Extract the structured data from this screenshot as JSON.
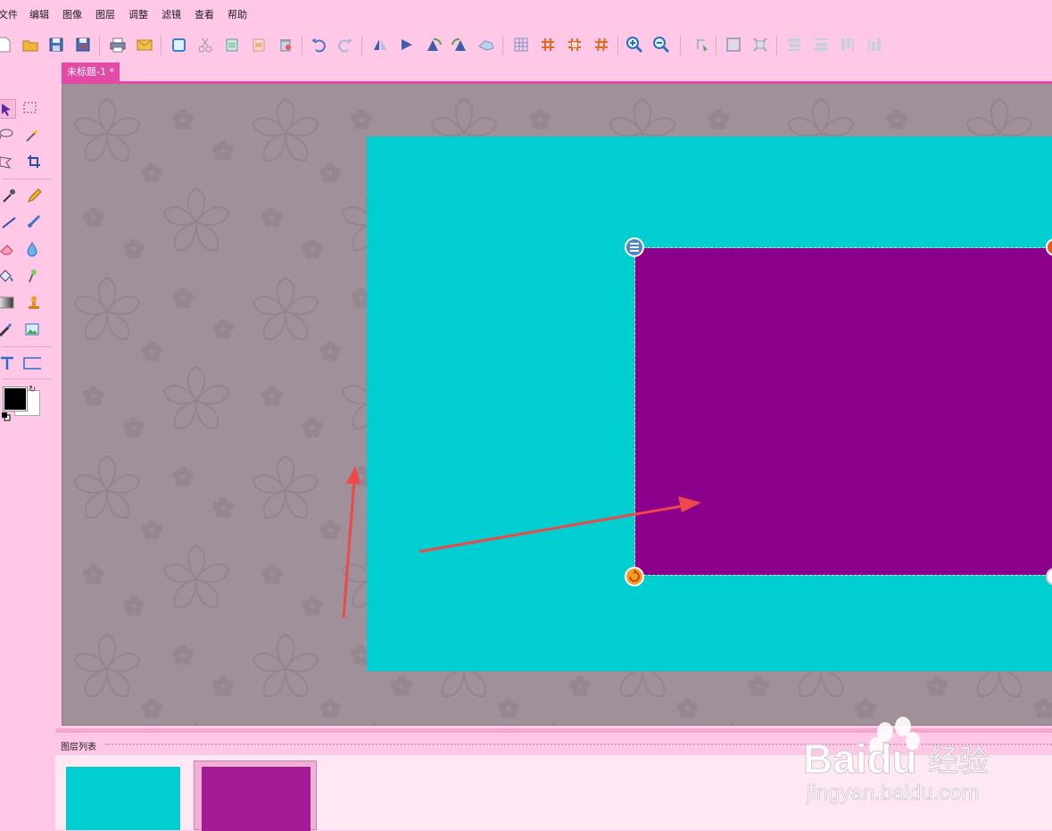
{
  "menu": [
    "文件",
    "编辑",
    "图像",
    "图层",
    "调整",
    "滤镜",
    "查看",
    "帮助"
  ],
  "toolbar_icons": [
    "new-file-icon",
    "open-folder-icon",
    "save-icon",
    "save-as-icon",
    "print-icon",
    "email-icon",
    "copy-icon",
    "cut-icon",
    "paste-icon",
    "clear-icon",
    "trash-icon",
    "undo-icon",
    "redo-icon",
    "flip-horizontal-icon",
    "flip-vertical-icon",
    "rotate-left-icon",
    "rotate-right-icon",
    "rotate-icon",
    "grid-icon",
    "hash-grid-icon",
    "crop-grid-icon",
    "hash-icon",
    "zoom-in-icon",
    "zoom-out-icon",
    "select-tool-icon",
    "fit-icon",
    "actual-size-icon",
    "align-top-icon",
    "align-bottom-icon",
    "align-left-icon",
    "align-right-icon"
  ],
  "tab": {
    "title": "未标题-1 *"
  },
  "layers": {
    "title": "图层列表"
  },
  "colors": {
    "accent": "#e24aa6",
    "chrome": "#ffc8e6",
    "canvas_fill": "#00ced1",
    "layer_fill": "#8b008b",
    "arrow": "#f04848",
    "foreground": "#000000",
    "background": "#ffffff"
  },
  "watermark": {
    "brand": "Baidu",
    "product": "经验",
    "url": "jingyan.baidu.com"
  }
}
